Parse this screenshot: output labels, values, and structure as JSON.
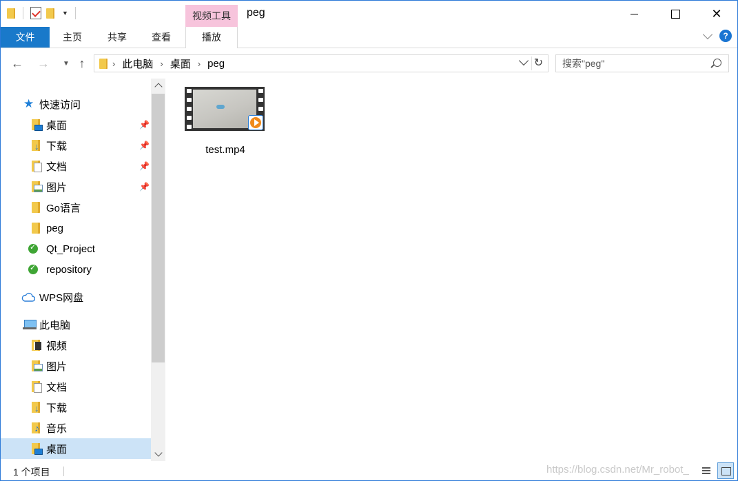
{
  "window": {
    "title": "peg",
    "context_tab_group": "视频工具"
  },
  "ribbon": {
    "tabs": [
      {
        "label": "文件"
      },
      {
        "label": "主页"
      },
      {
        "label": "共享"
      },
      {
        "label": "查看"
      },
      {
        "label": "播放"
      }
    ],
    "help_label": "?"
  },
  "address": {
    "breadcrumbs": [
      "此电脑",
      "桌面",
      "peg"
    ],
    "search_placeholder": "搜索\"peg\""
  },
  "navigation": {
    "quick_access_label": "快速访问",
    "quick_access_items": [
      {
        "label": "桌面",
        "icon": "desktop-folder-icon",
        "pinned": true
      },
      {
        "label": "下载",
        "icon": "downloads-folder-icon",
        "pinned": true
      },
      {
        "label": "文档",
        "icon": "documents-folder-icon",
        "pinned": true
      },
      {
        "label": "图片",
        "icon": "pictures-folder-icon",
        "pinned": true
      },
      {
        "label": "Go语言",
        "icon": "folder-icon",
        "pinned": false
      },
      {
        "label": "peg",
        "icon": "folder-icon",
        "pinned": false
      },
      {
        "label": "Qt_Project",
        "icon": "synced-folder-icon",
        "pinned": false
      },
      {
        "label": "repository",
        "icon": "synced-folder-icon",
        "pinned": false
      }
    ],
    "wps_label": "WPS网盘",
    "this_pc_label": "此电脑",
    "this_pc_items": [
      {
        "label": "视频",
        "icon": "videos-folder-icon"
      },
      {
        "label": "图片",
        "icon": "pictures-folder-icon"
      },
      {
        "label": "文档",
        "icon": "documents-folder-icon"
      },
      {
        "label": "下载",
        "icon": "downloads-folder-icon"
      },
      {
        "label": "音乐",
        "icon": "music-folder-icon"
      },
      {
        "label": "桌面",
        "icon": "desktop-folder-icon",
        "selected": true
      }
    ]
  },
  "files": [
    {
      "name": "test.mp4",
      "icon": "video-file-icon"
    }
  ],
  "status": {
    "item_count": "1 个项目",
    "watermark": "https://blog.csdn.net/Mr_robot_"
  },
  "colors": {
    "accent": "#1979ca",
    "context_tab": "#f7c4dc",
    "selection": "#cce3f7"
  }
}
